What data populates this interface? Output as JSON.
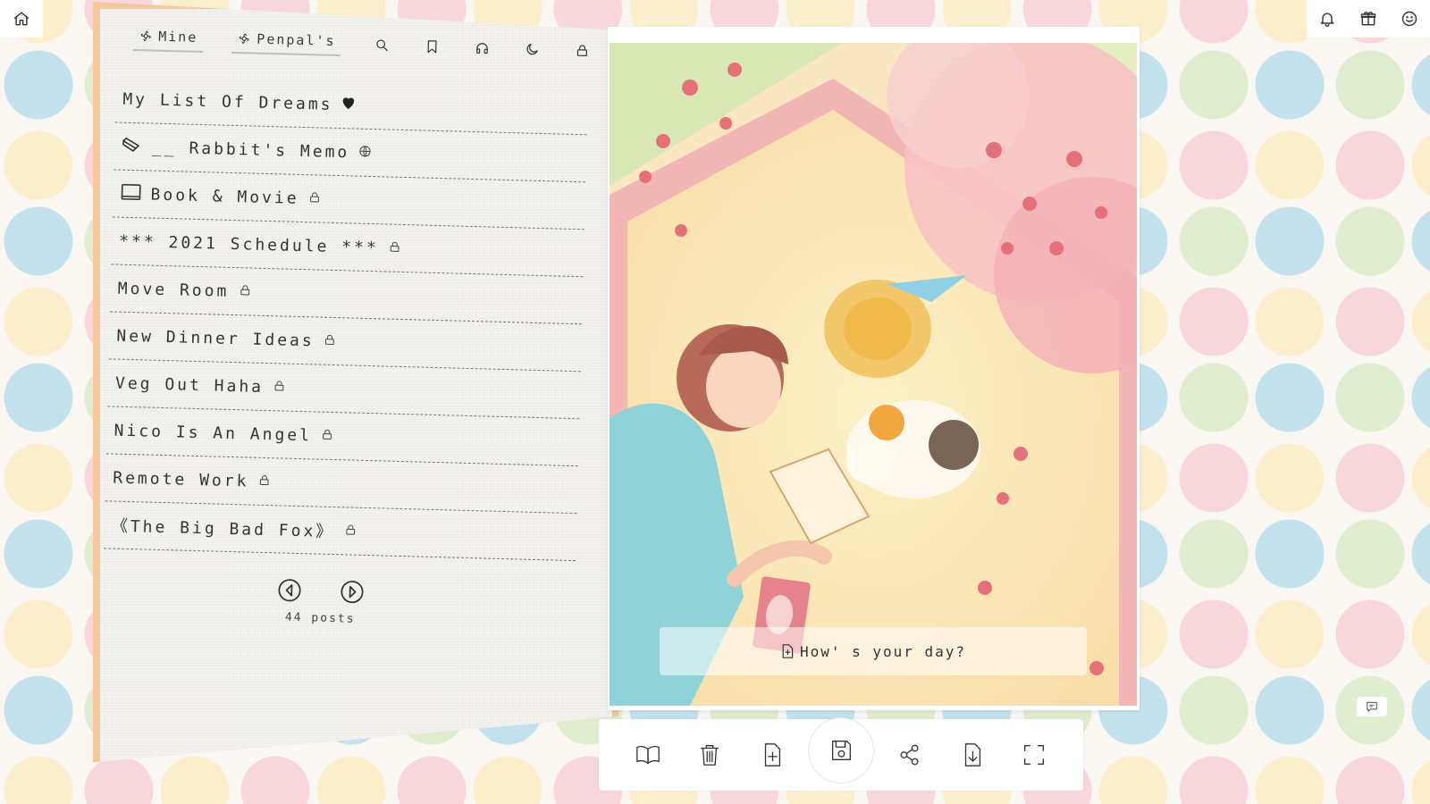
{
  "app": {
    "top_left_icon": "home-icon",
    "top_right_icons": [
      "bell-icon",
      "gift-icon",
      "smiley-icon"
    ]
  },
  "sidebar": {
    "tabs": [
      {
        "label": "Mine",
        "icon": "flower-icon"
      },
      {
        "label": "Penpal's",
        "icon": "flower-icon"
      }
    ],
    "tools": [
      "search-icon",
      "bookmark-icon",
      "headphones-icon",
      "moon-icon",
      "lock-icon"
    ],
    "entries": [
      {
        "title": "My List Of Dreams",
        "lead": "",
        "badge": "heart"
      },
      {
        "title": "__ Rabbit's Memo",
        "lead": "pencil",
        "badge": "globe"
      },
      {
        "title": "Book & Movie",
        "lead": "book",
        "badge": "lock"
      },
      {
        "title": "*** 2021 Schedule ***",
        "lead": "",
        "badge": "lock"
      },
      {
        "title": "Move Room",
        "lead": "",
        "badge": "lock"
      },
      {
        "title": "New Dinner Ideas",
        "lead": "",
        "badge": "lock"
      },
      {
        "title": "Veg Out Haha",
        "lead": "",
        "badge": "lock"
      },
      {
        "title": "Nico Is An Angel",
        "lead": "",
        "badge": "lock"
      },
      {
        "title": "Remote Work",
        "lead": "",
        "badge": "lock"
      },
      {
        "title": "《The Big Bad Fox》",
        "lead": "",
        "badge": "lock"
      }
    ],
    "post_count": "44 posts"
  },
  "page": {
    "prompt": "How' s your day?",
    "illustration": "watercolor-girl-reading-with-cat"
  },
  "toolbar": {
    "buttons": [
      "book-open-icon",
      "trash-icon",
      "file-plus-icon",
      "save-icon",
      "share-icon",
      "download-icon",
      "fullscreen-icon"
    ]
  },
  "colors": {
    "notebook_border": "#f6c79a",
    "paper": "#f3f2ef",
    "dots": [
      "#96d2e8",
      "#f6bec8",
      "#fce8aa",
      "#c4e4aa"
    ]
  }
}
